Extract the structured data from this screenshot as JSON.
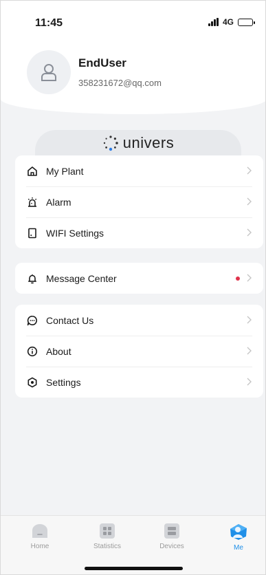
{
  "status_bar": {
    "time": "11:45",
    "network": "4G"
  },
  "profile": {
    "name": "EndUser",
    "email": "358231672@qq.com"
  },
  "brand": {
    "name": "univers"
  },
  "menu_groups": [
    [
      {
        "label": "My Plant",
        "icon": "home-icon"
      },
      {
        "label": "Alarm",
        "icon": "alarm-icon"
      },
      {
        "label": "WIFI Settings",
        "icon": "device-icon"
      }
    ],
    [
      {
        "label": "Message Center",
        "icon": "bell-icon",
        "badge": "unread-dot"
      }
    ],
    [
      {
        "label": "Contact Us",
        "icon": "chat-icon"
      },
      {
        "label": "About",
        "icon": "info-icon"
      },
      {
        "label": "Settings",
        "icon": "settings-icon"
      }
    ]
  ],
  "tabs": [
    {
      "label": "Home",
      "icon": "home-tab-icon"
    },
    {
      "label": "Statistics",
      "icon": "statistics-tab-icon"
    },
    {
      "label": "Devices",
      "icon": "devices-tab-icon"
    },
    {
      "label": "Me",
      "icon": "me-tab-icon",
      "active": true
    }
  ],
  "colors": {
    "accent": "#1f8fe8",
    "badge": "#e0324b",
    "background": "#f2f3f5"
  }
}
